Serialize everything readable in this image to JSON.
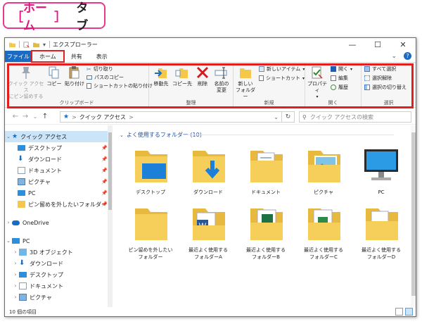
{
  "callout": {
    "bracket_open": "［",
    "name": "ホーム",
    "bracket_close": "］",
    "suffix": "タブ"
  },
  "window": {
    "title": "エクスプローラー",
    "qat_dropdown": "▾",
    "controls": {
      "minimize": "—",
      "maximize": "☐",
      "close": "✕"
    }
  },
  "tabs": {
    "file": "ファイル",
    "items": [
      {
        "label": "ホーム"
      },
      {
        "label": "共有"
      },
      {
        "label": "表示"
      }
    ],
    "expand": "⌄",
    "help": "?"
  },
  "ribbon": {
    "clipboard": {
      "label": "クリップボード",
      "pin": "クイック アクセス\nにピン留めする",
      "copy": "コピー",
      "paste": "貼り付け",
      "cut": "切り取り",
      "copy_path": "パスのコピー",
      "paste_shortcut": "ショートカットの貼り付け"
    },
    "organize": {
      "label": "整理",
      "move_to": "移動先",
      "copy_to": "コピー先",
      "delete": "削除",
      "rename": "名前の\n変更"
    },
    "new": {
      "label": "新規",
      "new_folder": "新しい\nフォルダー",
      "new_item": "新しいアイテム",
      "shortcut": "ショートカット"
    },
    "open": {
      "label": "開く",
      "properties": "プロパティ",
      "open": "開く",
      "edit": "編集",
      "history": "履歴"
    },
    "select": {
      "label": "選択",
      "select_all": "すべて選択",
      "select_none": "選択解除",
      "invert": "選択の切り替え"
    }
  },
  "address": {
    "back": "←",
    "forward": "→",
    "recent": "⌄",
    "up": "↑",
    "separator": ">",
    "location": "クイック アクセス",
    "dropdown": "⌄",
    "refresh": "↻",
    "search_placeholder": "クイック アクセスの検索"
  },
  "nav": {
    "quick_access": "クイック アクセス",
    "pinned": [
      {
        "label": "デスクトップ"
      },
      {
        "label": "ダウンロード"
      },
      {
        "label": "ドキュメント"
      },
      {
        "label": "ピクチャ"
      },
      {
        "label": "PC"
      },
      {
        "label": "ピン留めを外したいフォルダー"
      }
    ],
    "onedrive": "OneDrive",
    "pc": "PC",
    "pc_children": [
      {
        "label": "3D オブジェクト"
      },
      {
        "label": "ダウンロード"
      },
      {
        "label": "デスクトップ"
      },
      {
        "label": "ドキュメント"
      },
      {
        "label": "ピクチャ"
      }
    ]
  },
  "content": {
    "group_header": "よく使用するフォルダー (10)",
    "items": [
      {
        "label": "デスクトップ"
      },
      {
        "label": "ダウンロード"
      },
      {
        "label": "ドキュメント"
      },
      {
        "label": "ピクチャ"
      },
      {
        "label": "PC"
      },
      {
        "label": "ピン留めを外したい\nフォルダー"
      },
      {
        "label": "最近よく使用する\nフォルダーA"
      },
      {
        "label": "最近よく使用する\nフォルダーB"
      },
      {
        "label": "最近よく使用する\nフォルダーC"
      },
      {
        "label": "最近よく使用する\nフォルダーD"
      }
    ]
  },
  "status": {
    "count": "10 個の項目"
  },
  "colors": {
    "accent_blue": "#1a6bc4",
    "highlight_red": "#e02020",
    "callout_pink": "#e6398f",
    "folder_yellow": "#f5c84b"
  }
}
